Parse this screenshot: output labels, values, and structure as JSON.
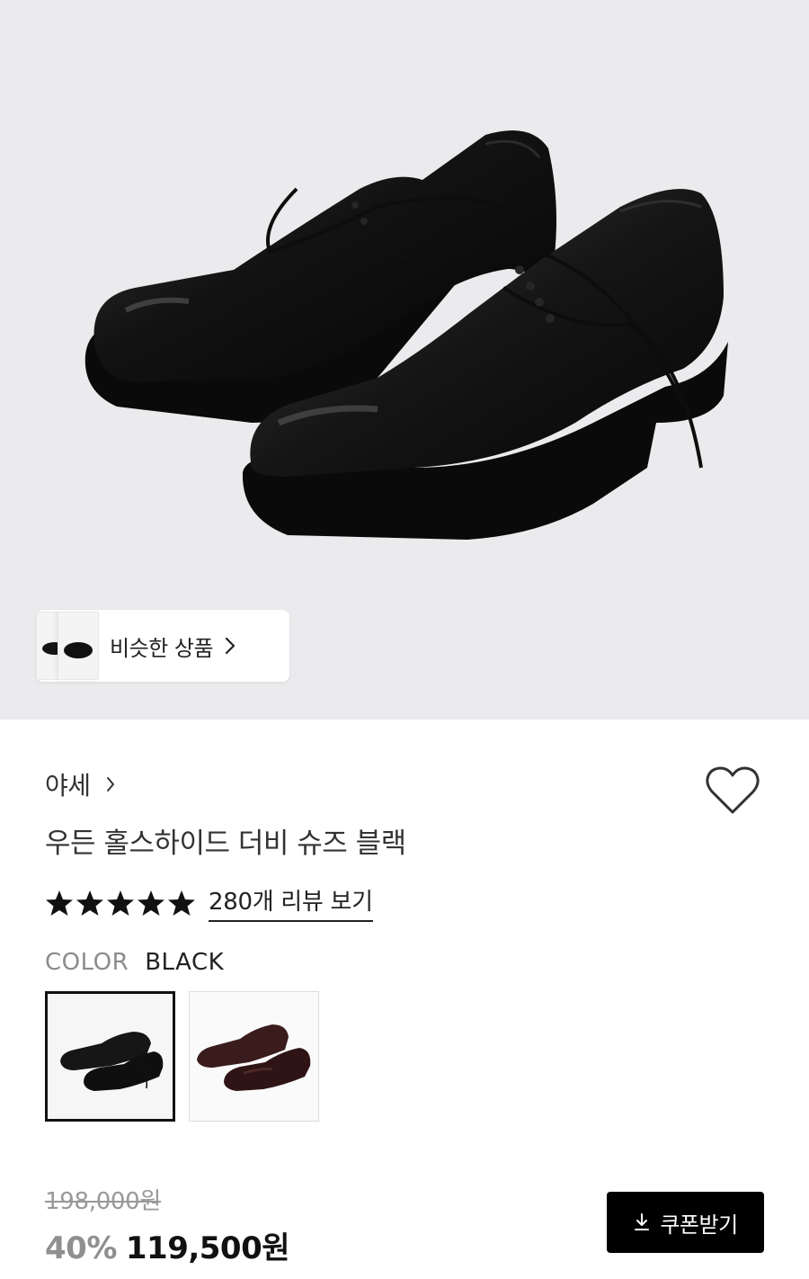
{
  "hero": {
    "similar_label": "비슷한 상품",
    "similar_icon": "chevron-right-icon"
  },
  "product": {
    "brand": "야세",
    "title": "우든 홀스하이드 더비 슈즈 블랙",
    "rating_stars": 5,
    "review_link": "280개 리뷰 보기",
    "wishlist_icon": "heart-outline-icon"
  },
  "color": {
    "key": "COLOR",
    "selected": "BLACK",
    "options": [
      "black",
      "brown"
    ]
  },
  "price": {
    "original": "198,000원",
    "discount": "40%",
    "sale": "119,500원"
  },
  "coupon": {
    "label": "쿠폰받기",
    "icon": "download-icon"
  },
  "colors": {
    "hero_bg": "#ebebed",
    "button_bg": "#000000",
    "muted_text": "#8f8f8f",
    "shoe_black": "#141414",
    "shoe_brown": "#3a1c1c"
  }
}
